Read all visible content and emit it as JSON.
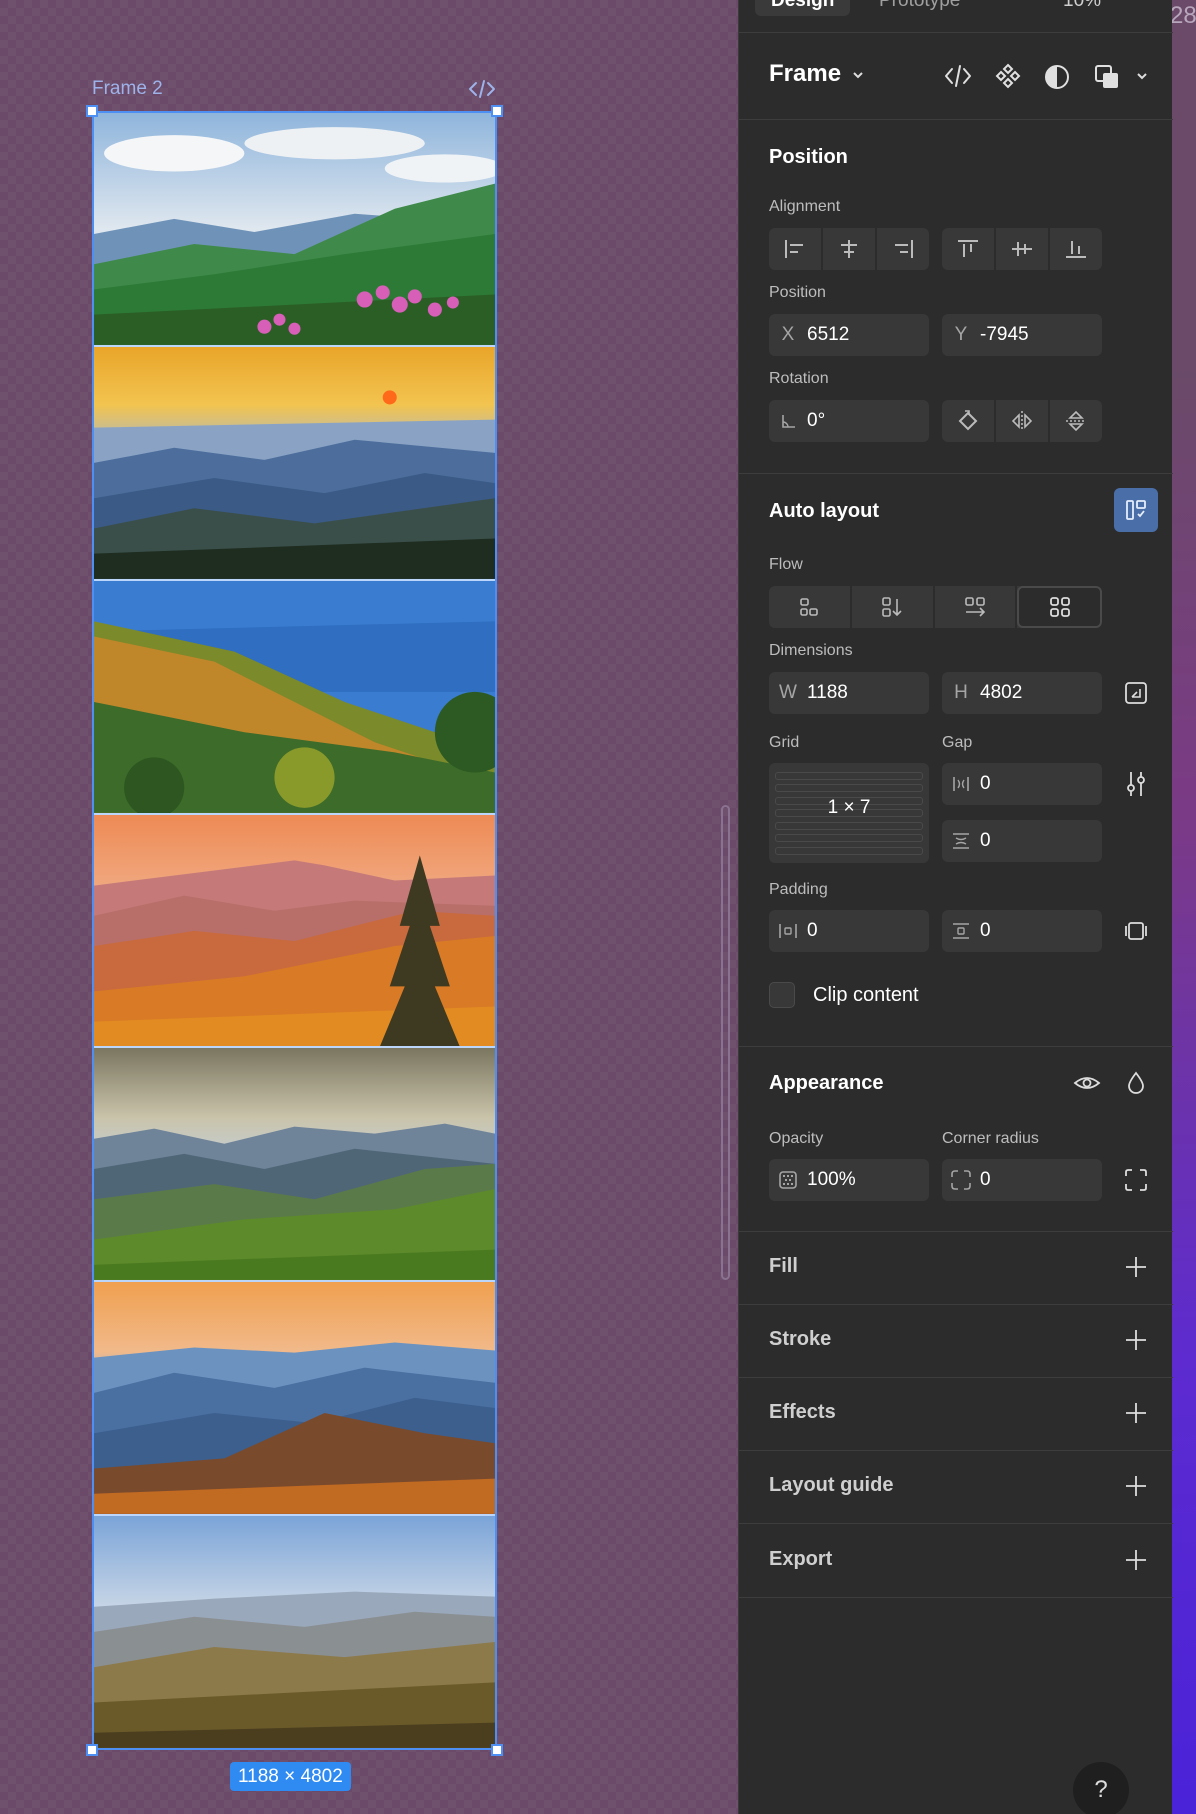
{
  "canvas": {
    "frame_label": "Frame 2",
    "size_badge": "1188 × 4802",
    "photos": [
      {
        "name": "mountain-rhododendron-photo"
      },
      {
        "name": "sunset-ridges-photo"
      },
      {
        "name": "autumn-blue-valley-photo"
      },
      {
        "name": "orange-autumn-pine-photo"
      },
      {
        "name": "cloudy-green-ridges-photo"
      },
      {
        "name": "blue-ridges-orange-sky-photo"
      },
      {
        "name": "hazy-fall-forest-photo"
      }
    ]
  },
  "right_strip_text": "28",
  "panel": {
    "tabs": [
      "Design",
      "Prototype"
    ],
    "zoom": "10%",
    "frame_title": "Frame",
    "position": {
      "title": "Position",
      "alignment_label": "Alignment",
      "position_label": "Position",
      "x_prefix": "X",
      "x_value": "6512",
      "y_prefix": "Y",
      "y_value": "-7945",
      "rotation_label": "Rotation",
      "rotation_value": "0°"
    },
    "auto_layout": {
      "title": "Auto layout",
      "flow_label": "Flow",
      "dimensions_label": "Dimensions",
      "w_prefix": "W",
      "w_value": "1188",
      "h_prefix": "H",
      "h_value": "4802",
      "grid_label": "Grid",
      "gap_label": "Gap",
      "grid_value": "1 × 7",
      "gap_h_value": "0",
      "gap_v_value": "0",
      "padding_label": "Padding",
      "padding_h_value": "0",
      "padding_v_value": "0",
      "clip_label": "Clip content"
    },
    "appearance": {
      "title": "Appearance",
      "opacity_label": "Opacity",
      "opacity_value": "100%",
      "radius_label": "Corner radius",
      "radius_value": "0"
    },
    "sections": [
      "Fill",
      "Stroke",
      "Effects",
      "Layout guide",
      "Export"
    ],
    "help": "?"
  },
  "colors": {
    "canvas_bg": "#6a4a68",
    "panel_bg": "#2c2c2c",
    "selection": "#4d8ff2",
    "badge": "#2f8bf2"
  }
}
